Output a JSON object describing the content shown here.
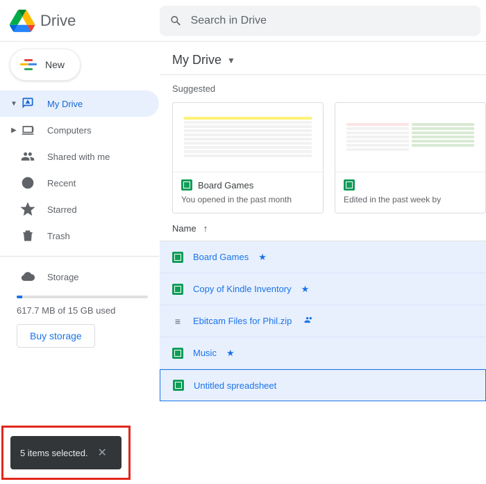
{
  "brand": {
    "name": "Drive"
  },
  "search": {
    "placeholder": "Search in Drive"
  },
  "new_label": "New",
  "sidebar": {
    "items": [
      {
        "label": "My Drive"
      },
      {
        "label": "Computers"
      },
      {
        "label": "Shared with me"
      },
      {
        "label": "Recent"
      },
      {
        "label": "Starred"
      },
      {
        "label": "Trash"
      },
      {
        "label": "Storage"
      }
    ],
    "storage_used": "617.7 MB of 15 GB used",
    "buy_label": "Buy storage"
  },
  "breadcrumb": "My Drive",
  "suggested": {
    "heading": "Suggested",
    "cards": [
      {
        "title": "Board Games",
        "subtitle": "You opened in the past month"
      },
      {
        "title": "",
        "subtitle": "Edited in the past week by"
      }
    ]
  },
  "list": {
    "column": "Name",
    "rows": [
      {
        "name": "Board Games",
        "type": "sheets",
        "starred": true
      },
      {
        "name": "Copy of Kindle Inventory",
        "type": "sheets",
        "starred": true
      },
      {
        "name": "Ebitcam Files for Phil.zip",
        "type": "zip",
        "shared": true
      },
      {
        "name": "Music",
        "type": "sheets",
        "starred": true
      },
      {
        "name": "Untitled spreadsheet",
        "type": "sheets"
      }
    ]
  },
  "toast": {
    "text": "5 items selected.",
    "count": 5
  }
}
